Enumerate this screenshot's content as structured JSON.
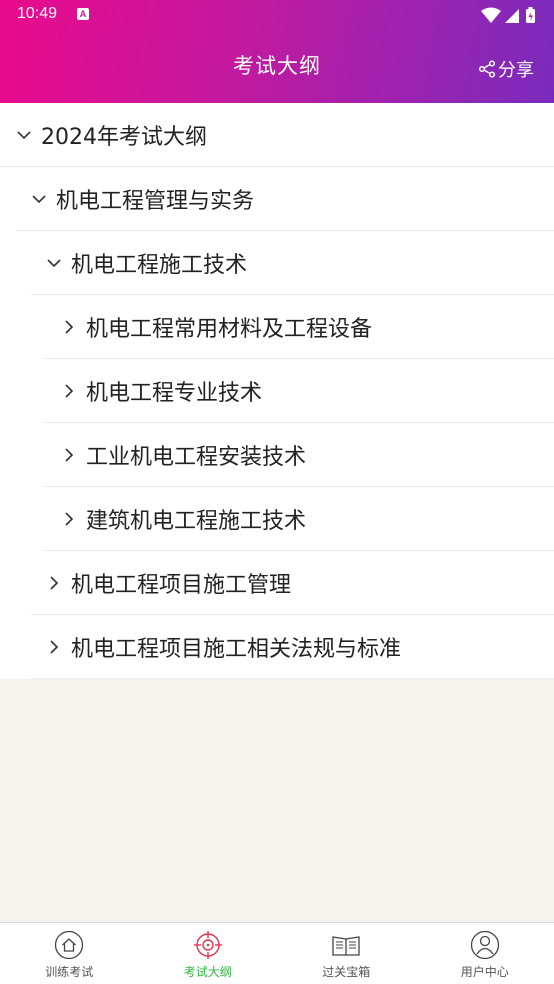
{
  "status": {
    "time": "10:49",
    "notification_glyph": "A"
  },
  "header": {
    "title": "考试大纲",
    "share_label": "分享"
  },
  "tree": [
    {
      "level": 0,
      "expanded": true,
      "label": "2024年考试大纲"
    },
    {
      "level": 1,
      "expanded": true,
      "label": "机电工程管理与实务"
    },
    {
      "level": 2,
      "expanded": true,
      "label": "机电工程施工技术"
    },
    {
      "level": 3,
      "expanded": false,
      "label": "机电工程常用材料及工程设备"
    },
    {
      "level": 3,
      "expanded": false,
      "label": "机电工程专业技术"
    },
    {
      "level": 3,
      "expanded": false,
      "label": "工业机电工程安装技术"
    },
    {
      "level": 3,
      "expanded": false,
      "label": "建筑机电工程施工技术"
    },
    {
      "level": 2,
      "expanded": false,
      "label": "机电工程项目施工管理"
    },
    {
      "level": 2,
      "expanded": false,
      "label": "机电工程项目施工相关法规与标准"
    }
  ],
  "tabs": [
    {
      "label": "训练考试",
      "icon": "home-icon",
      "active": false
    },
    {
      "label": "考试大纲",
      "icon": "target-icon",
      "active": true
    },
    {
      "label": "过关宝箱",
      "icon": "book-icon",
      "active": false
    },
    {
      "label": "用户中心",
      "icon": "user-icon",
      "active": false
    }
  ],
  "colors": {
    "active_tab": "#2db83d",
    "inactive_tab": "#555555",
    "header_start": "#ea0a8c",
    "header_end": "#7a2bbd"
  }
}
